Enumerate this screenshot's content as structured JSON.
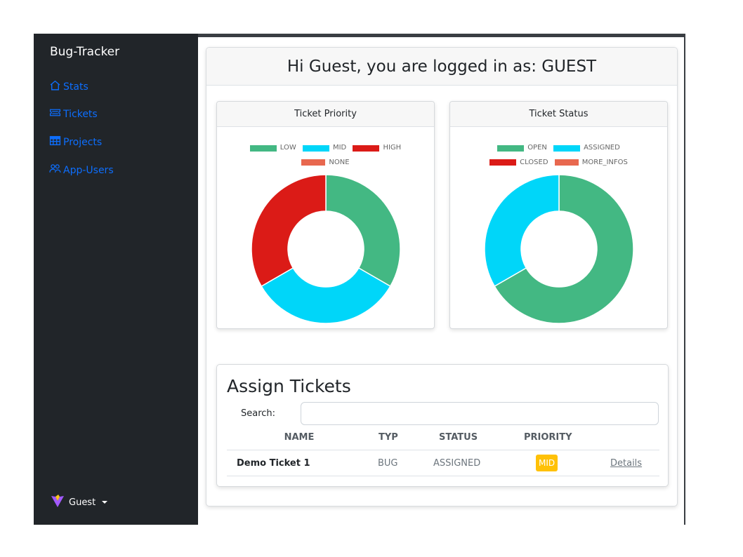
{
  "sidebar": {
    "brand": "Bug-Tracker",
    "items": [
      {
        "label": "Stats",
        "icon": "house-icon"
      },
      {
        "label": "Tickets",
        "icon": "ticket-icon"
      },
      {
        "label": "Projects",
        "icon": "table-icon"
      },
      {
        "label": "App-Users",
        "icon": "people-icon"
      }
    ],
    "user": "Guest"
  },
  "header": {
    "title": "Hi Guest, you are logged in as: GUEST"
  },
  "chart_data": [
    {
      "type": "pie",
      "title": "Ticket Priority",
      "categories": [
        "LOW",
        "MID",
        "HIGH",
        "NONE"
      ],
      "values": [
        1,
        1,
        1,
        0
      ],
      "colors": [
        "#43b883",
        "#00d6f9",
        "#db1b17",
        "#e8684f"
      ],
      "legend": "top"
    },
    {
      "type": "pie",
      "title": "Ticket Status",
      "categories": [
        "OPEN",
        "ASSIGNED",
        "CLOSED",
        "MORE_INFOS"
      ],
      "values": [
        2,
        1,
        0,
        0
      ],
      "colors": [
        "#43b883",
        "#00d6f9",
        "#db1b17",
        "#e8684f"
      ],
      "legend": "top"
    }
  ],
  "tickets": {
    "title": "Assign Tickets",
    "search_label": "Search:",
    "search_value": "",
    "columns": [
      "NAME",
      "TYP",
      "STATUS",
      "PRIORITY"
    ],
    "rows": [
      {
        "name": "Demo Ticket 1",
        "typ": "BUG",
        "status": "ASSIGNED",
        "priority": "MID",
        "link": "Details"
      }
    ],
    "priority_color": "#ffc107"
  }
}
